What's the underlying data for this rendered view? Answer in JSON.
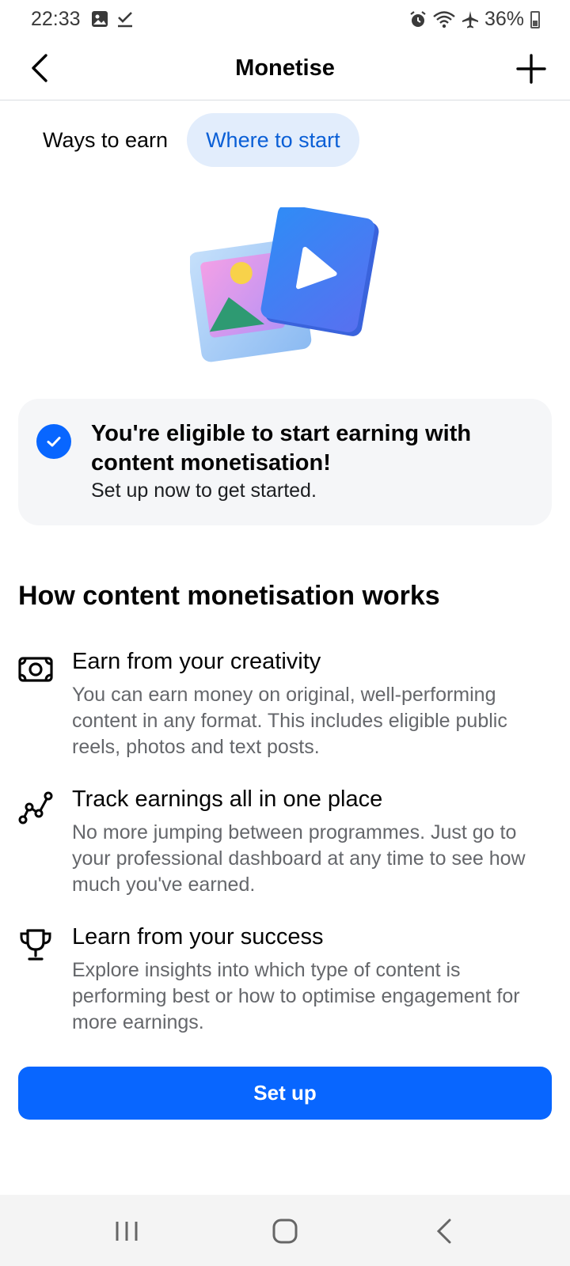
{
  "status_bar": {
    "time": "22:33",
    "battery": "36%",
    "left_icons": [
      "image-icon",
      "check-icon"
    ],
    "right_icons": [
      "alarm-icon",
      "wifi-icon",
      "airplane-icon",
      "battery-icon"
    ]
  },
  "header": {
    "title": "Monetise",
    "back_icon": "chevron-left-icon",
    "add_icon": "plus-icon"
  },
  "tabs": [
    {
      "label": "Ways to earn",
      "selected": false
    },
    {
      "label": "Where to start",
      "selected": true
    }
  ],
  "illustration": {
    "icon": "photo-video-icon"
  },
  "eligibility": {
    "heading": "You're eligible to start earning with content monetisation!",
    "subtext": "Set up now to get started."
  },
  "section": {
    "heading": "How content monetisation works"
  },
  "features": [
    {
      "icon": "money-icon",
      "title": "Earn from your creativity",
      "description": "You can earn money on original, well-performing content in any format. This includes eligible public reels, photos and text posts."
    },
    {
      "icon": "trend-line-icon",
      "title": "Track earnings all in one place",
      "description": "No more jumping between programmes. Just go to your professional dashboard at any time to see how much you've earned."
    },
    {
      "icon": "trophy-icon",
      "title": "Learn from your success",
      "description": "Explore insights into which type of content is performing best or how to optimise engagement for more earnings."
    }
  ],
  "actions": {
    "setup_label": "Set up"
  },
  "colors": {
    "accent": "#0866ff",
    "tab_selected_bg": "#e2edfc",
    "tab_selected_text": "#0a5fd6",
    "card_bg": "#f5f6f8",
    "secondary_text": "#65676b"
  }
}
